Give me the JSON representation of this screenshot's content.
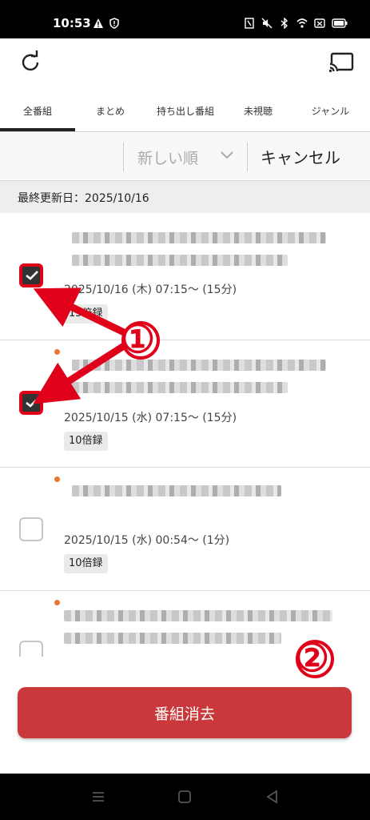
{
  "status": {
    "time": "10:53"
  },
  "tabs": [
    "全番組",
    "まとめ",
    "持ち出し番組",
    "未視聴",
    "ジャンル"
  ],
  "sort": {
    "label": "新しい順",
    "cancel": "キャンセル"
  },
  "updated": "最終更新日：2025/10/16",
  "items": [
    {
      "datetime": "2025/10/16 (木) 07:15〜 (15分)",
      "badge": "15倍録",
      "checked": true
    },
    {
      "datetime": "2025/10/15 (水) 07:15〜 (15分)",
      "badge": "10倍録",
      "checked": true
    },
    {
      "datetime": "2025/10/15 (水) 00:54〜 (1分)",
      "badge": "10倍録",
      "checked": false
    },
    {
      "datetime": "",
      "badge": "",
      "checked": false
    }
  ],
  "annotations": {
    "label1": "①",
    "label2": "②"
  },
  "delete_button": "番組消去",
  "colors": {
    "accent": "#c9383a",
    "annotation": "#e0001a",
    "unread_dot": "#e8782f"
  },
  "icons": {
    "refresh": "refresh-icon",
    "cast": "cast-icon",
    "sort_chevron": "chevron-down-icon"
  }
}
